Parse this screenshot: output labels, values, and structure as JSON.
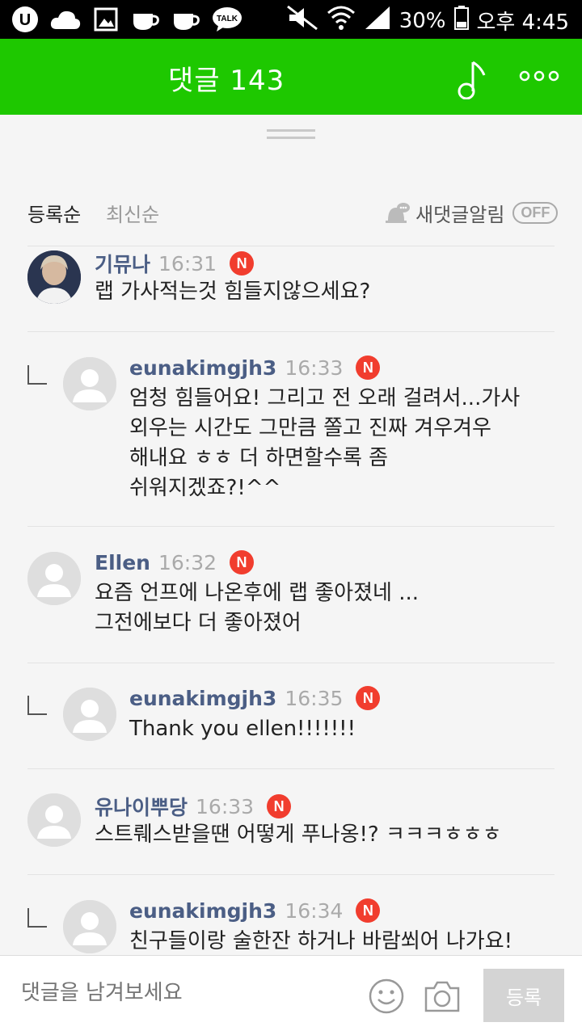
{
  "status_bar": {
    "battery": "30%",
    "time": "오후 4:45",
    "icons": [
      "u-plus-icon",
      "cloud-icon",
      "image-icon",
      "cup-icon",
      "cup-icon",
      "talk-icon",
      "mute-icon",
      "wifi-icon",
      "signal-icon",
      "battery-icon"
    ]
  },
  "header": {
    "title": "댓글 143",
    "icons": [
      "music-note-icon",
      "more-icon"
    ],
    "accent": "#1ec800"
  },
  "sort": {
    "active": "등록순",
    "inactive": "최신순",
    "alarm_label": "새댓글알림",
    "alarm_state": "OFF"
  },
  "comments": [
    {
      "name": "기뮤나",
      "time": "16:31",
      "badge": "N",
      "text": "랩 가사적는것 힘들지않으세요?",
      "reply": false
    },
    {
      "name": "eunakimgjh3",
      "time": "16:33",
      "badge": "N",
      "text": "엄청 힘들어요! 그리고 전 오래 걸려서...가사\n외우는 시간도 그만큼 쫄고 진짜 겨우겨우\n해내요 ㅎㅎ 더 하면할수록 좀\n쉬워지겠죠?!^^",
      "reply": true
    },
    {
      "name": "Ellen",
      "time": "16:32",
      "badge": "N",
      "text": "요즘 언프에 나온후에 랩 좋아졌네 ...\n그전에보다 더 좋아졌어",
      "reply": false
    },
    {
      "name": "eunakimgjh3",
      "time": "16:35",
      "badge": "N",
      "text": "Thank you ellen!!!!!!!",
      "reply": true
    },
    {
      "name": "유나이뿌당",
      "time": "16:33",
      "badge": "N",
      "text": "스트뤠스받을땐 어떻게 푸나옹!? ㅋㅋㅋㅎㅎㅎ",
      "reply": false
    },
    {
      "name": "eunakimgjh3",
      "time": "16:34",
      "badge": "N",
      "text": "친구들이랑 술한잔 하거나 바람쐬어 나가요!",
      "reply": true
    }
  ],
  "input": {
    "placeholder": "댓글을 남겨보세요",
    "submit_label": "등록",
    "icons": [
      "emoji-icon",
      "camera-icon"
    ]
  }
}
